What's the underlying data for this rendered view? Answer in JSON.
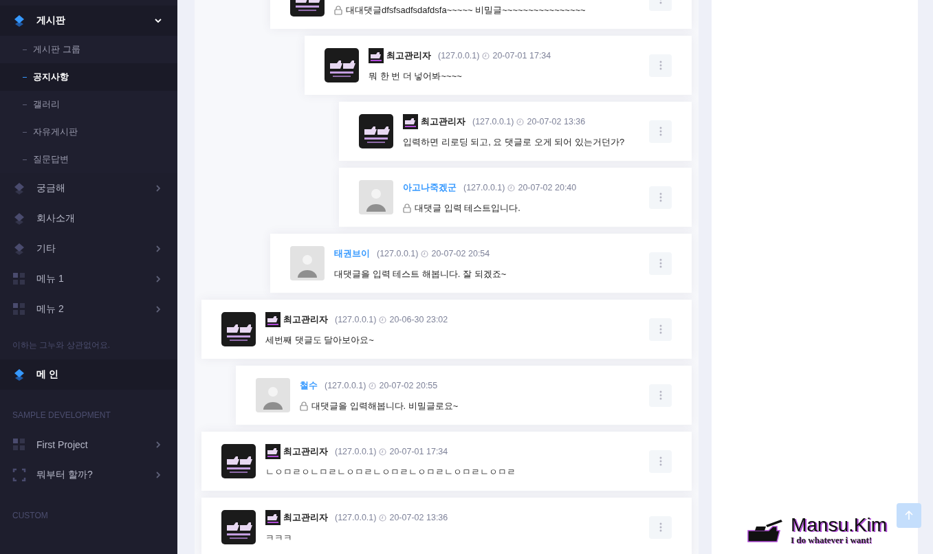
{
  "sidebar": {
    "items": [
      {
        "kind": "layers",
        "label": "게시판",
        "selected": true,
        "expanded": true,
        "children": [
          {
            "label": "게시판 그룹",
            "selected": false
          },
          {
            "label": "공지사항",
            "selected": true
          },
          {
            "label": "갤러리",
            "selected": false
          },
          {
            "label": "자유게시판",
            "selected": false
          },
          {
            "label": "질문답변",
            "selected": false
          }
        ]
      },
      {
        "kind": "layers",
        "label": "궁금해",
        "selected": false,
        "expanded": false
      },
      {
        "kind": "layers",
        "label": "회사소개",
        "selected": false
      },
      {
        "kind": "layers",
        "label": "기타",
        "selected": false,
        "expanded": false
      },
      {
        "kind": "grid",
        "label": "메뉴 1",
        "selected": false,
        "expanded": false
      },
      {
        "kind": "grid",
        "label": "메뉴 2",
        "selected": false,
        "expanded": false
      },
      {
        "kind": "note",
        "label": "이하는 그누와 상관없어요."
      },
      {
        "kind": "layers",
        "label": "메 인",
        "selected": true
      },
      {
        "kind": "section",
        "label": "SAMPLE DEVELOPMENT"
      },
      {
        "kind": "grid",
        "label": "First Project",
        "selected": false,
        "expanded": false
      },
      {
        "kind": "frame",
        "label": "뭐부터 할까?",
        "selected": false,
        "expanded": false
      },
      {
        "kind": "section",
        "label": "CUSTOM"
      }
    ]
  },
  "comments": [
    {
      "kind": "continued",
      "children": [
        {
          "kind": "continued",
          "children": [
            {
              "kind": "member",
              "secret": true,
              "body": "대대댓글dfsfsadfsdafdsfa~~~~~ 비밀글~~~~~~~~~~~~~~~~",
              "children": [
                {
                  "kind": "member",
                  "author": "최고관리자",
                  "ip": "(127.0.0.1)",
                  "date": "20-07-01 17:34",
                  "secret": false,
                  "body": "뭐 한 번 더 넣어봐~~~~",
                  "children": [
                    {
                      "kind": "member",
                      "author": "최고관리자",
                      "ip": "(127.0.0.1)",
                      "date": "20-07-02 13:36",
                      "secret": false,
                      "body": "입력하면 리로딩 되고, 요 댓글로 오게 되어 있는거던가?"
                    },
                    {
                      "kind": "guest",
                      "author": "아고나죽겠군",
                      "ip": "(127.0.0.1)",
                      "date": "20-07-02 20:40",
                      "secret": true,
                      "body": "대댓글 입력 테스트입니다."
                    }
                  ]
                }
              ]
            },
            {
              "kind": "guest",
              "author": "태권브이",
              "ip": "(127.0.0.1)",
              "date": "20-07-02 20:54",
              "secret": false,
              "body": "대댓글을 입력 테스트 해봅니다. 잘 되겠죠~"
            }
          ]
        }
      ]
    },
    {
      "kind": "member",
      "author": "최고관리자",
      "ip": "(127.0.0.1)",
      "date": "20-06-30 23:02",
      "secret": false,
      "body": "세번째 댓글도 달아보아요~",
      "children": [
        {
          "kind": "guest",
          "author": "철수",
          "ip": "(127.0.0.1)",
          "date": "20-07-02 20:55",
          "secret": true,
          "body": "대댓글을 입력해봅니다. 비밀글로요~"
        }
      ]
    },
    {
      "kind": "member",
      "author": "최고관리자",
      "ip": "(127.0.0.1)",
      "date": "20-07-01 17:34",
      "secret": false,
      "body": "ㄴㅇㅁㄹㅇㄴㅁㄹㄴㅇㅁㄹㄴㅇㅁㄹㄴㅇㅁㄹㄴㅇㅁㄹㄴㅇㅁㄹ"
    },
    {
      "kind": "member",
      "author": "최고관리자",
      "ip": "(127.0.0.1)",
      "date": "20-07-02 13:36",
      "secret": false,
      "body": "ㅋㅋㅋ"
    }
  ],
  "logo": {
    "title": "Mansu.Kim",
    "tagline": "I do whatever i want!"
  }
}
